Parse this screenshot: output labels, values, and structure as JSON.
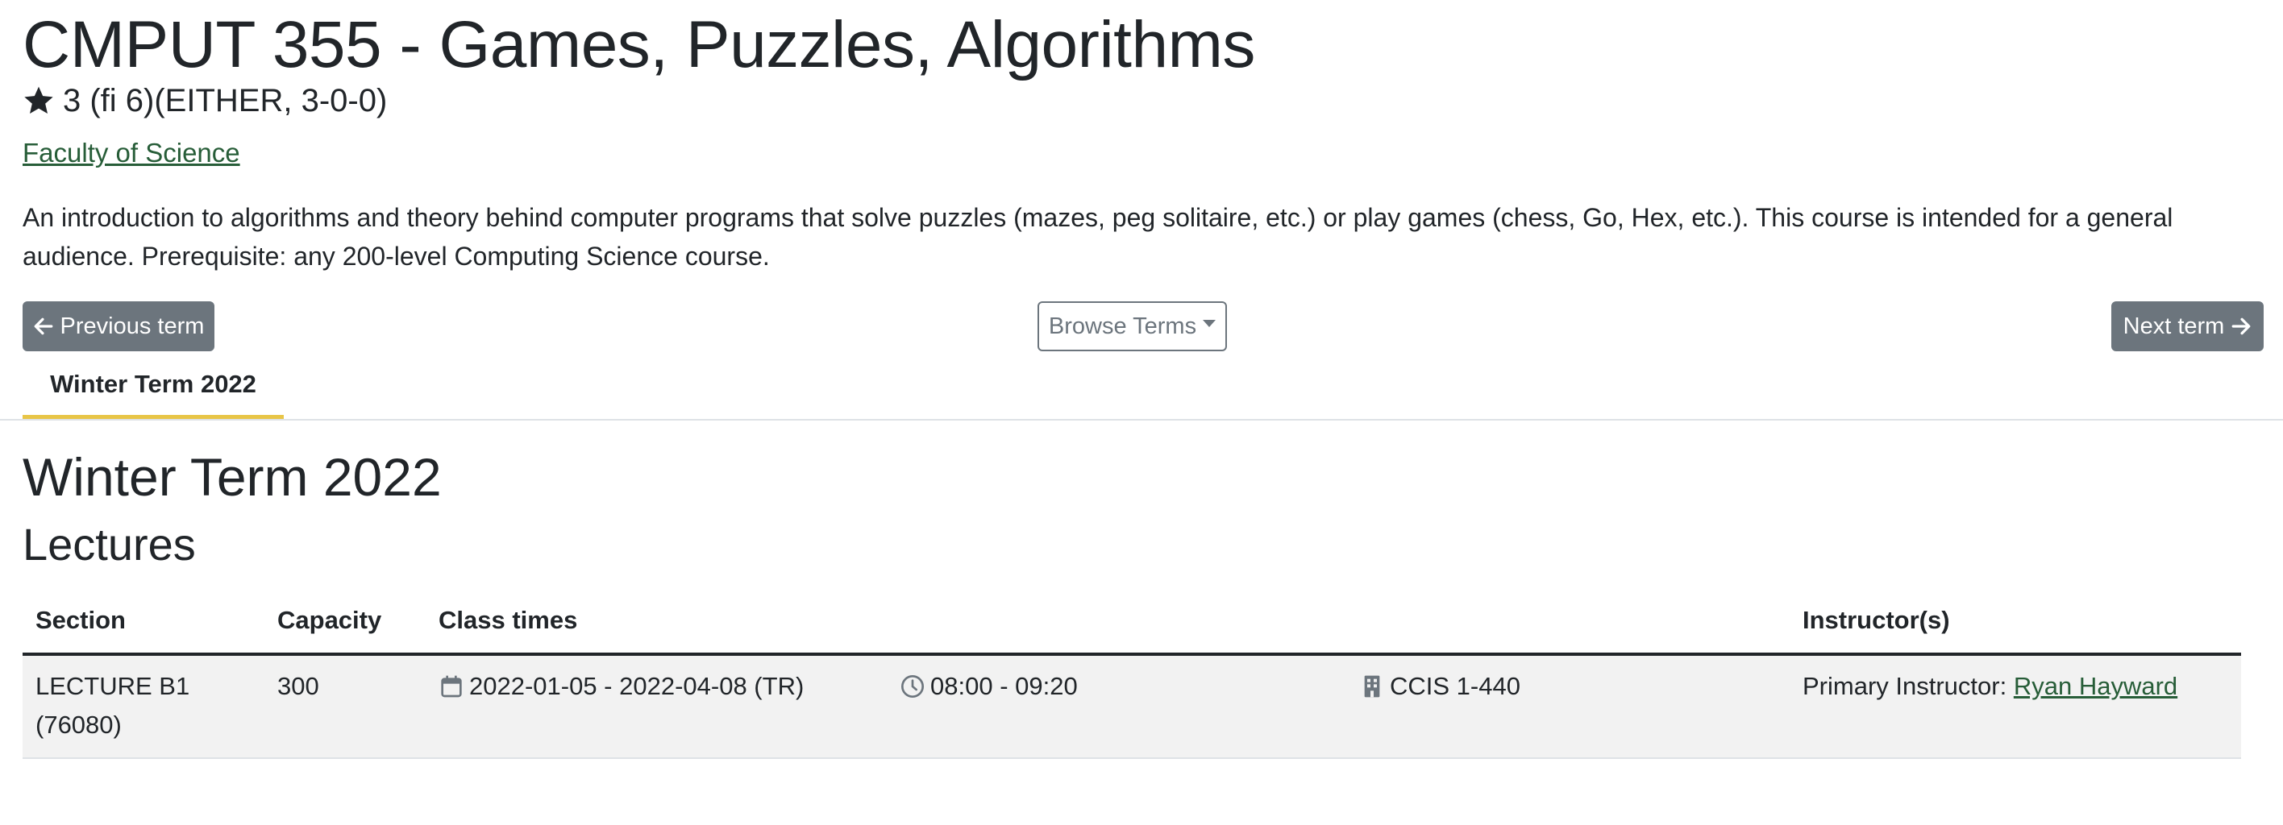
{
  "course": {
    "title": "CMPUT 355 - Games, Puzzles, Algorithms",
    "credits": "3 (fi 6)(EITHER, 3-0-0)",
    "faculty_link": "Faculty of Science",
    "description": "An introduction to algorithms and theory behind computer programs that solve puzzles (mazes, peg solitaire, etc.) or play games (chess, Go, Hex, etc.). This course is intended for a general audience. Prerequisite: any 200-level Computing Science course."
  },
  "nav": {
    "previous_label": "Previous term",
    "browse_label": "Browse Terms",
    "next_label": "Next term"
  },
  "tabs": [
    {
      "label": "Winter Term 2022",
      "active": true
    }
  ],
  "term": {
    "heading": "Winter Term 2022",
    "lectures_heading": "Lectures"
  },
  "table": {
    "headers": {
      "section": "Section",
      "capacity": "Capacity",
      "class_times": "Class times",
      "instructors": "Instructor(s)"
    },
    "rows": [
      {
        "section": "LECTURE B1 (76080)",
        "capacity": "300",
        "dates": "2022-01-05 - 2022-04-08 (TR)",
        "time": "08:00 - 09:20",
        "room": "CCIS 1-440",
        "instructor_prefix": "Primary Instructor:",
        "instructor_name": "Ryan Hayward"
      }
    ]
  },
  "colors": {
    "link": "#275d38",
    "tab_underline": "#e8c547",
    "button_secondary": "#6c757d"
  },
  "icons": {
    "credits": "star-icon",
    "dates": "calendar-icon",
    "time": "clock-icon",
    "room": "building-icon",
    "prev": "arrow-left-icon",
    "next": "arrow-right-icon",
    "browse": "caret-down-icon"
  }
}
